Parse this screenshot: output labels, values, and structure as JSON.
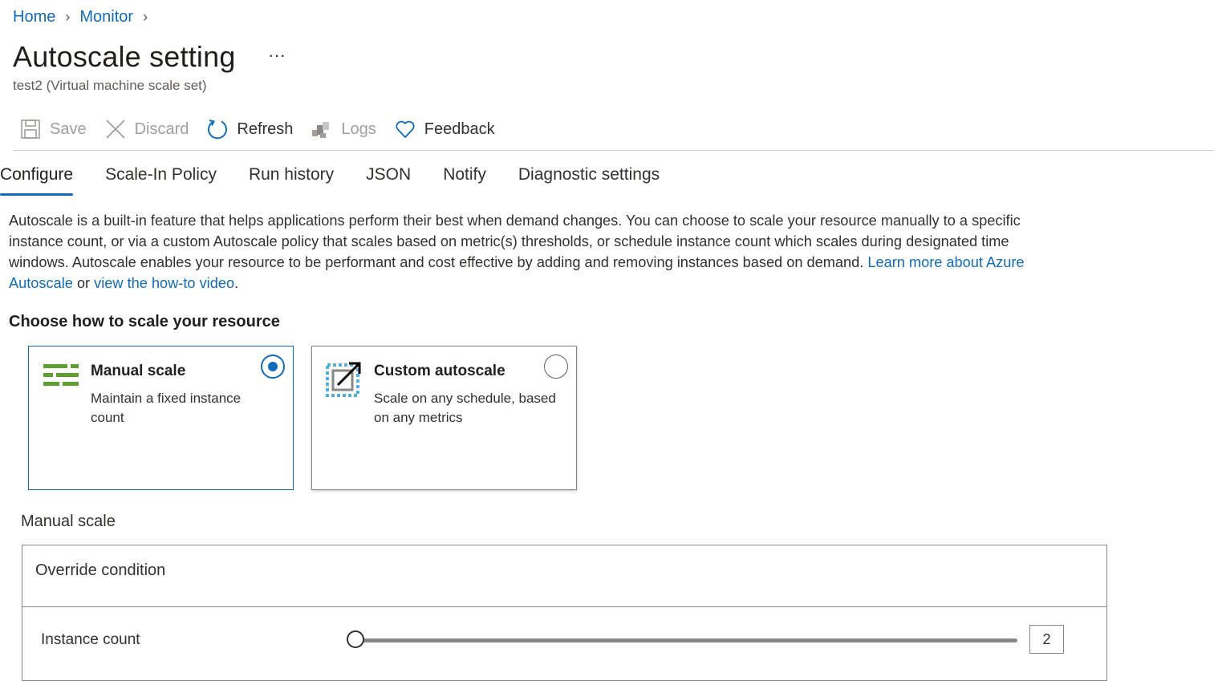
{
  "breadcrumb": [
    {
      "label": "Home"
    },
    {
      "label": "Monitor"
    }
  ],
  "breadcrumb_separator": "›",
  "page": {
    "title": "Autoscale setting",
    "more": "···",
    "subtitle": "test2 (Virtual machine scale set)"
  },
  "toolbar": {
    "save": "Save",
    "discard": "Discard",
    "refresh": "Refresh",
    "logs": "Logs",
    "feedback": "Feedback"
  },
  "tabs": [
    {
      "label": "Configure",
      "active": true
    },
    {
      "label": "Scale-In Policy"
    },
    {
      "label": "Run history"
    },
    {
      "label": "JSON"
    },
    {
      "label": "Notify"
    },
    {
      "label": "Diagnostic settings"
    }
  ],
  "description": {
    "text": "Autoscale is a built-in feature that helps applications perform their best when demand changes. You can choose to scale your resource manually to a specific instance count, or via a custom Autoscale policy that scales based on metric(s) thresholds, or schedule instance count which scales during designated time windows. Autoscale enables your resource to be performant and cost effective by adding and removing instances based on demand.",
    "link1": "Learn more about Azure Autoscale",
    "connector": "or",
    "link2": "view the how-to video",
    "end": "."
  },
  "section_title": "Choose how to scale your resource",
  "options": {
    "manual": {
      "title": "Manual scale",
      "description": "Maintain a fixed instance count",
      "selected": true,
      "icon": "manual-scale-icon"
    },
    "custom": {
      "title": "Custom autoscale",
      "description": "Scale on any schedule, based on any metrics",
      "selected": false,
      "icon": "custom-autoscale-icon"
    }
  },
  "manual_scale": {
    "label": "Manual scale",
    "override_condition": "Override condition",
    "instance_count_label": "Instance count",
    "instance_count": "2",
    "slider_fraction": 0
  },
  "colors": {
    "accent": "#0f6cbd",
    "manual_icon_green": "#5ea030",
    "custom_icon_blue": "#50b0e0"
  }
}
